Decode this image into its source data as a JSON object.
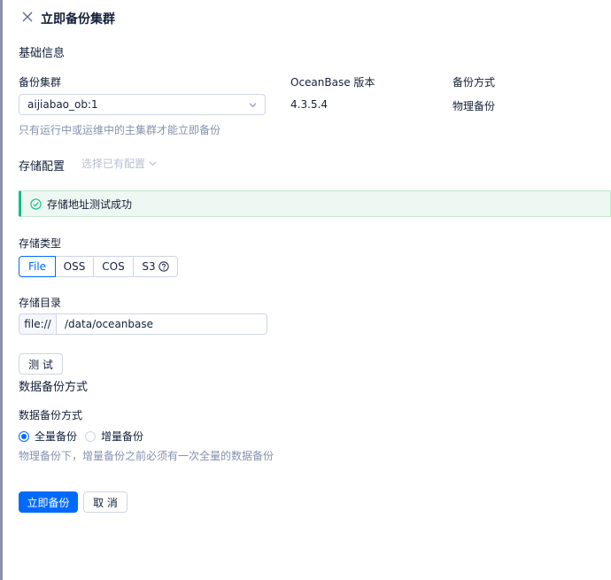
{
  "drawer": {
    "title": "立即备份集群"
  },
  "basic": {
    "section_title": "基础信息",
    "cluster_label": "备份集群",
    "cluster_value": "aijiabao_ob:1",
    "cluster_hint": "只有运行中或运维中的主集群才能立即备份",
    "version_label": "OceanBase 版本",
    "version_value": "4.3.5.4",
    "method_label": "备份方式",
    "method_value": "物理备份"
  },
  "storage": {
    "section_title": "存储配置",
    "preset_label": "选择已有配置",
    "alert_text": "存储地址测试成功",
    "type_label": "存储类型",
    "types": [
      "File",
      "OSS",
      "COS",
      "S3"
    ],
    "selected_type": "File",
    "dir_label": "存储目录",
    "dir_prefix": "file://",
    "dir_value": "/data/oceanbase",
    "test_button": "测 试"
  },
  "data_backup": {
    "section_title": "数据备份方式",
    "mode_label": "数据备份方式",
    "options": [
      "全量备份",
      "增量备份"
    ],
    "selected": "全量备份",
    "hint": "物理备份下，增量备份之前必须有一次全量的数据备份"
  },
  "footer": {
    "submit": "立即备份",
    "cancel": "取 消"
  },
  "colors": {
    "primary": "#006aff",
    "success": "#0ac185",
    "hint": "#8592ad",
    "border": "#cdd5e4"
  }
}
